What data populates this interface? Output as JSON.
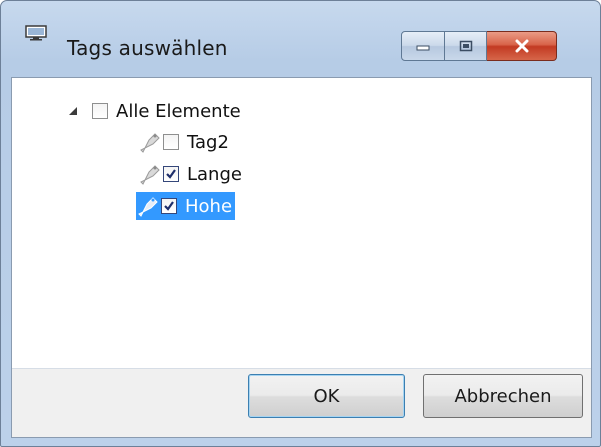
{
  "window": {
    "title": "Tags auswählen",
    "icon": "monitor-app-icon",
    "caption_buttons": [
      "minimize-icon",
      "maximize-icon",
      "close-icon"
    ]
  },
  "tree": {
    "root": {
      "label": "Alle Elemente",
      "checked": false,
      "expanded": true
    },
    "children": [
      {
        "label": "Tag2",
        "checked": false,
        "selected": false,
        "icon": "tag-icon"
      },
      {
        "label": "Lange",
        "checked": true,
        "selected": false,
        "icon": "tag-icon"
      },
      {
        "label": "Hohe",
        "checked": true,
        "selected": true,
        "icon": "tag-icon"
      }
    ]
  },
  "buttons": {
    "ok_label": "OK",
    "cancel_label": "Abbrechen"
  },
  "colors": {
    "selection": "#3399ff",
    "close_button": "#c7402a"
  }
}
